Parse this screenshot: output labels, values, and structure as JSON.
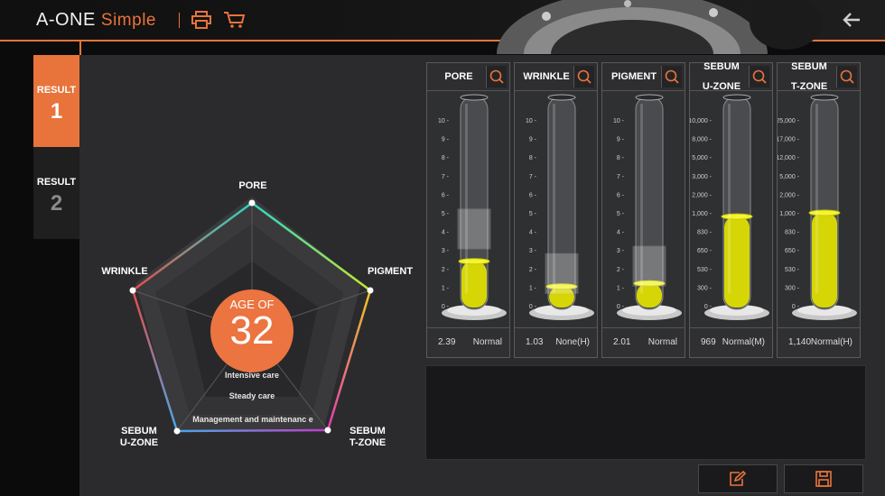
{
  "header": {
    "logo_main": "A-ONE",
    "logo_sub": "Simple"
  },
  "icons": {
    "print": "printer-icon",
    "cart": "cart-icon",
    "back": "arrow-left-icon"
  },
  "results": [
    {
      "label": "RESULT",
      "number": "1",
      "active": true
    },
    {
      "label": "RESULT",
      "number": "2",
      "active": false
    }
  ],
  "radar": {
    "labels": {
      "pore": "PORE",
      "pigment": "PIGMENT",
      "sebum_t_line1": "SEBUM",
      "sebum_t_line2": "T-ZONE",
      "sebum_u_line1": "SEBUM",
      "sebum_u_line2": "U-ZONE",
      "wrinkle": "WRINKLE"
    },
    "age_label": "AGE OF",
    "age_value": "32",
    "zones": [
      "Intensive care",
      "Steady care",
      "Management  and maintenanc e"
    ]
  },
  "panels": [
    {
      "title_line1": "PORE",
      "title_line2": "",
      "ticks": [
        "10",
        "9",
        "8",
        "7",
        "6",
        "5",
        "4",
        "3",
        "2",
        "1",
        "0"
      ],
      "value": "2.39",
      "status": "Normal",
      "level": 0.239,
      "sleeve": 0.52
    },
    {
      "title_line1": "WRINKLE",
      "title_line2": "",
      "ticks": [
        "10",
        "9",
        "8",
        "7",
        "6",
        "5",
        "4",
        "3",
        "2",
        "1",
        "0"
      ],
      "value": "1.03",
      "status": "None(H)",
      "level": 0.103,
      "sleeve": 0.28
    },
    {
      "title_line1": "PIGMENT",
      "title_line2": "",
      "ticks": [
        "10",
        "9",
        "8",
        "7",
        "6",
        "5",
        "4",
        "3",
        "2",
        "1",
        "0"
      ],
      "value": "2.01",
      "status": "Normal",
      "level": 0.12,
      "sleeve": 0.32
    },
    {
      "title_line1": "SEBUM",
      "title_line2": "U-ZONE",
      "ticks": [
        "10,000",
        "8,000",
        "5,000",
        "3,000",
        "2,000",
        "1,000",
        "830",
        "650",
        "530",
        "300",
        "0"
      ],
      "value": "969",
      "status": "Normal(M)",
      "level": 0.48,
      "sleeve": 0.0
    },
    {
      "title_line1": "SEBUM",
      "title_line2": "T-ZONE",
      "ticks": [
        "25,000",
        "17,000",
        "12,000",
        "5,000",
        "2,000",
        "1,000",
        "830",
        "650",
        "530",
        "300",
        "0"
      ],
      "value": "1,140",
      "status": "Normal(H)",
      "level": 0.5,
      "sleeve": 0.0
    }
  ],
  "colors": {
    "accent": "#e8743b",
    "liquid": "#e6e600"
  }
}
